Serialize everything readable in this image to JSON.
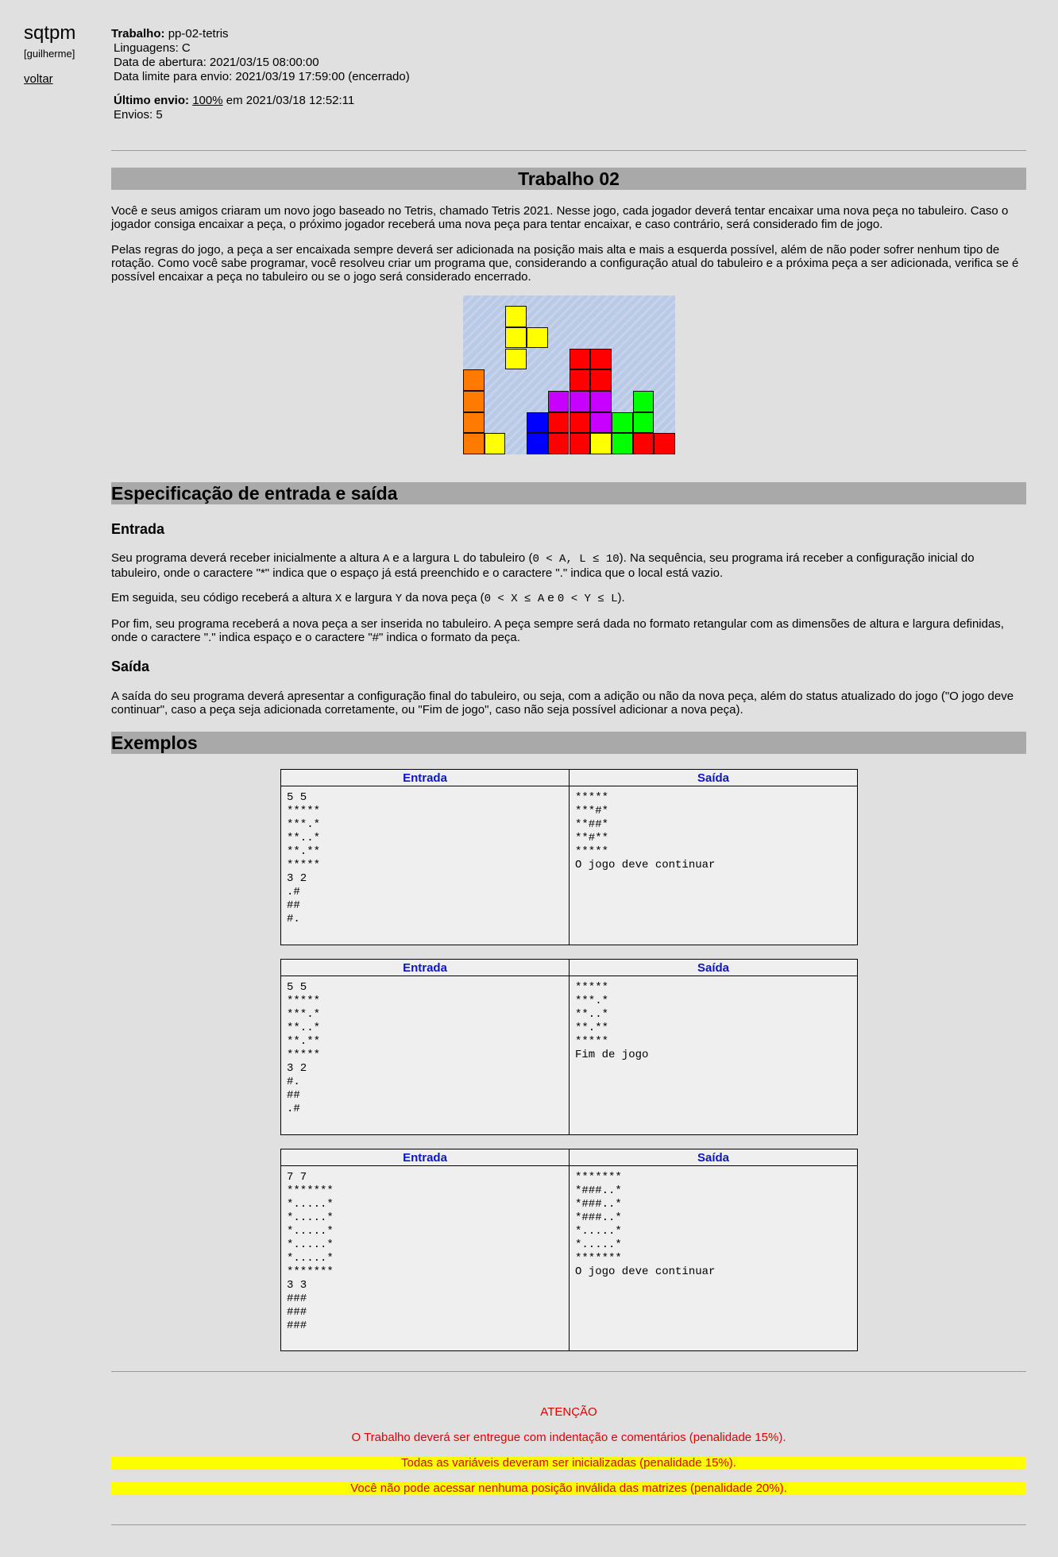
{
  "sidebar": {
    "brand": "sqtpm",
    "user": "[guilherme]",
    "back_label": "voltar"
  },
  "meta": {
    "job_label": "Trabalho:",
    "job_value": "pp-02-tetris",
    "languages": "Linguagens: C",
    "open_date": "Data de abertura: 2021/03/15 08:00:00",
    "due_date": "Data limite para envio: 2021/03/19 17:59:00 (encerrado)",
    "last_label": "Último envio:",
    "last_score": "100%",
    "last_date": "em 2021/03/18 12:52:11",
    "submissions": "Envios: 5"
  },
  "title": "Trabalho 02",
  "intro": {
    "p1": "Você e seus amigos criaram um novo jogo baseado no Tetris, chamado Tetris 2021. Nesse jogo, cada jogador deverá tentar encaixar uma nova peça no tabuleiro. Caso o jogador consiga encaixar a peça, o próximo jogador receberá uma nova peça para tentar encaixar, e caso contrário, será considerado fim de jogo.",
    "p2": "Pelas regras do jogo, a peça a ser encaixada sempre deverá ser adicionada na posição mais alta e mais a esquerda possível, além de não poder sofrer nenhum tipo de rotação. Como você sabe programar, você resolveu criar um programa que, considerando a configuração atual do tabuleiro e a próxima peça a ser adicionada, verifica se é possível encaixar a peça no tabuleiro ou se o jogo será considerado encerrado."
  },
  "tetris_image": {
    "colors": {
      "orange": "#ff7a00",
      "yellow": "#ffff00",
      "red": "#ff0000",
      "purple": "#c800ff",
      "blue": "#0000ff",
      "green": "#00ff00",
      "background": "#b9c9e6"
    },
    "cells": [
      {
        "c": 2,
        "r": 0,
        "color": "yellow"
      },
      {
        "c": 2,
        "r": 1,
        "color": "yellow"
      },
      {
        "c": 3,
        "r": 1,
        "color": "yellow"
      },
      {
        "c": 2,
        "r": 2,
        "color": "yellow"
      },
      {
        "c": 0,
        "r": 3,
        "color": "orange"
      },
      {
        "c": 0,
        "r": 4,
        "color": "orange"
      },
      {
        "c": 0,
        "r": 5,
        "color": "orange"
      },
      {
        "c": 0,
        "r": 6,
        "color": "orange"
      },
      {
        "c": 1,
        "r": 6,
        "color": "yellow"
      },
      {
        "c": 5,
        "r": 2,
        "color": "red"
      },
      {
        "c": 6,
        "r": 2,
        "color": "red"
      },
      {
        "c": 5,
        "r": 3,
        "color": "red"
      },
      {
        "c": 6,
        "r": 3,
        "color": "red"
      },
      {
        "c": 4,
        "r": 4,
        "color": "purple"
      },
      {
        "c": 5,
        "r": 4,
        "color": "purple"
      },
      {
        "c": 6,
        "r": 4,
        "color": "purple"
      },
      {
        "c": 8,
        "r": 4,
        "color": "green"
      },
      {
        "c": 3,
        "r": 5,
        "color": "blue"
      },
      {
        "c": 4,
        "r": 5,
        "color": "red"
      },
      {
        "c": 5,
        "r": 5,
        "color": "red"
      },
      {
        "c": 6,
        "r": 5,
        "color": "purple"
      },
      {
        "c": 7,
        "r": 5,
        "color": "green"
      },
      {
        "c": 8,
        "r": 5,
        "color": "green"
      },
      {
        "c": 3,
        "r": 6,
        "color": "blue"
      },
      {
        "c": 4,
        "r": 6,
        "color": "red"
      },
      {
        "c": 5,
        "r": 6,
        "color": "red"
      },
      {
        "c": 6,
        "r": 6,
        "color": "yellow"
      },
      {
        "c": 7,
        "r": 6,
        "color": "green"
      },
      {
        "c": 8,
        "r": 6,
        "color": "red"
      },
      {
        "c": 9,
        "r": 6,
        "color": "red"
      }
    ]
  },
  "spec": {
    "heading": "Especificação de entrada e saída",
    "input_heading": "Entrada",
    "input_p1_a": "Seu programa deverá receber inicialmente a altura ",
    "input_p1_A": "A",
    "input_p1_b": " e a largura ",
    "input_p1_L": "L",
    "input_p1_c": " do tabuleiro (",
    "input_p1_cond": "0 < A, L ≤ 10",
    "input_p1_d": "). Na sequência, seu programa irá receber a configuração inicial do tabuleiro, onde o caractere \"*\" indica que o espaço já está preenchido e o caractere \".\" indica que o local está vazio.",
    "input_p2_a": "Em seguida, seu código receberá a altura ",
    "input_p2_X": "X",
    "input_p2_b": " e largura ",
    "input_p2_Y": "Y",
    "input_p2_c": " da nova peça (",
    "input_p2_cond1": "0 < X ≤ A",
    "input_p2_e": " e ",
    "input_p2_cond2": "0 < Y ≤ L",
    "input_p2_d": ").",
    "input_p3": "Por fim, seu programa receberá a nova peça a ser inserida no tabuleiro. A peça sempre será dada no formato retangular com as dimensões de altura e largura definidas, onde o caractere \".\" indica espaço e o caractere \"#\" indica o formato da peça.",
    "output_heading": "Saída",
    "output_p1": "A saída do seu programa deverá apresentar a configuração final do tabuleiro, ou seja, com a adição ou não da nova peça, além do status atualizado do jogo (\"O jogo deve continuar\", caso a peça seja adicionada corretamente, ou \"Fim de jogo\", caso não seja possível adicionar a nova peça)."
  },
  "examples": {
    "heading": "Exemplos",
    "col_input": "Entrada",
    "col_output": "Saída",
    "items": [
      {
        "input": "5 5\n*****\n***.*\n**..*\n**.**\n*****\n3 2\n.#\n##\n#.",
        "output": "*****\n***#*\n**##*\n**#**\n*****\nO jogo deve continuar"
      },
      {
        "input": "5 5\n*****\n***.*\n**..*\n**.**\n*****\n3 2\n#.\n##\n.#",
        "output": "*****\n***.*\n**..*\n**.**\n*****\nFim de jogo"
      },
      {
        "input": "7 7\n*******\n*.....*\n*.....*\n*.....*\n*.....*\n*.....*\n*******\n3 3\n###\n###\n###",
        "output": "*******\n*###..*\n*###..*\n*###..*\n*.....*\n*.....*\n*******\nO jogo deve continuar"
      }
    ]
  },
  "attention": {
    "title": "ATENÇÃO",
    "line1": "O Trabalho deverá ser entregue com indentação e comentários (penalidade 15%).",
    "line2": "Todas as variáveis deveram ser inicializadas (penalidade 15%).",
    "line3": "Você não pode acessar nenhuma posição inválida das matrizes (penalidade 20%)."
  }
}
